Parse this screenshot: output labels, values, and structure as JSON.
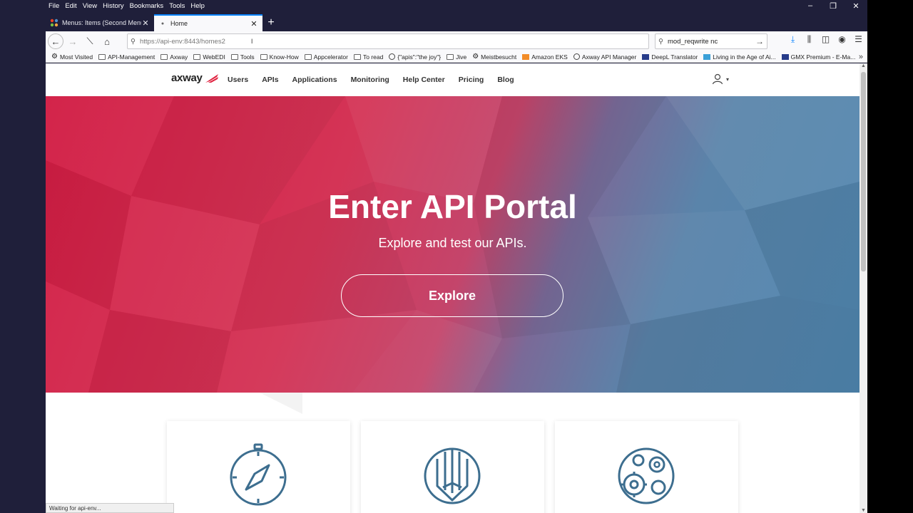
{
  "menubar": {
    "items": [
      "File",
      "Edit",
      "View",
      "History",
      "Bookmarks",
      "Tools",
      "Help"
    ]
  },
  "window_controls": {
    "minimize": "–",
    "restore": "❐",
    "close": "✕"
  },
  "tabs": [
    {
      "label": "Menus: Items (Second Menu)",
      "icon": "joomla-icon",
      "active": false
    },
    {
      "label": "Home",
      "icon": "loading-dot-icon",
      "active": true
    }
  ],
  "navbar": {
    "url": "https://api-env:8443/homes2",
    "search_value": "mod_reqwrite nc"
  },
  "bookmarks": [
    {
      "label": "Most Visited",
      "icon": "gear-icon"
    },
    {
      "label": "API-Management",
      "icon": "folder-icon"
    },
    {
      "label": "Axway",
      "icon": "folder-icon"
    },
    {
      "label": "WebEDI",
      "icon": "folder-icon"
    },
    {
      "label": "Tools",
      "icon": "folder-icon"
    },
    {
      "label": "Know-How",
      "icon": "folder-icon"
    },
    {
      "label": "Appcelerator",
      "icon": "folder-icon"
    },
    {
      "label": "To read",
      "icon": "folder-icon"
    },
    {
      "label": "{\"apis\":\"the joy\"}",
      "icon": "globe-icon"
    },
    {
      "label": "Jive",
      "icon": "folder-icon"
    },
    {
      "label": "Meistbesucht",
      "icon": "gear-icon"
    },
    {
      "label": "Amazon EKS",
      "icon": "aws-icon"
    },
    {
      "label": "Axway API Manager",
      "icon": "globe-icon"
    },
    {
      "label": "DeepL Translator",
      "icon": "deepl-icon"
    },
    {
      "label": "Living in the Age of Ai...",
      "icon": "vimeo-icon"
    },
    {
      "label": "GMX Premium - E-Ma...",
      "icon": "gmx-icon"
    }
  ],
  "site": {
    "logo_text": "axway",
    "nav": [
      "Users",
      "APIs",
      "Applications",
      "Monitoring",
      "Help Center",
      "Pricing",
      "Blog"
    ]
  },
  "hero": {
    "title": "Enter API Portal",
    "subtitle": "Explore and test our APIs.",
    "button": "Explore"
  },
  "cards": [
    {
      "icon": "compass-icon"
    },
    {
      "icon": "pencil-shield-icon"
    },
    {
      "icon": "gears-globe-icon"
    }
  ],
  "status": "Waiting for api-env...",
  "colors": {
    "hero_red": "#d21c43",
    "hero_blue": "#4f86b0",
    "icon_blue": "#3d6e8f",
    "accent": "#0a84ff"
  }
}
